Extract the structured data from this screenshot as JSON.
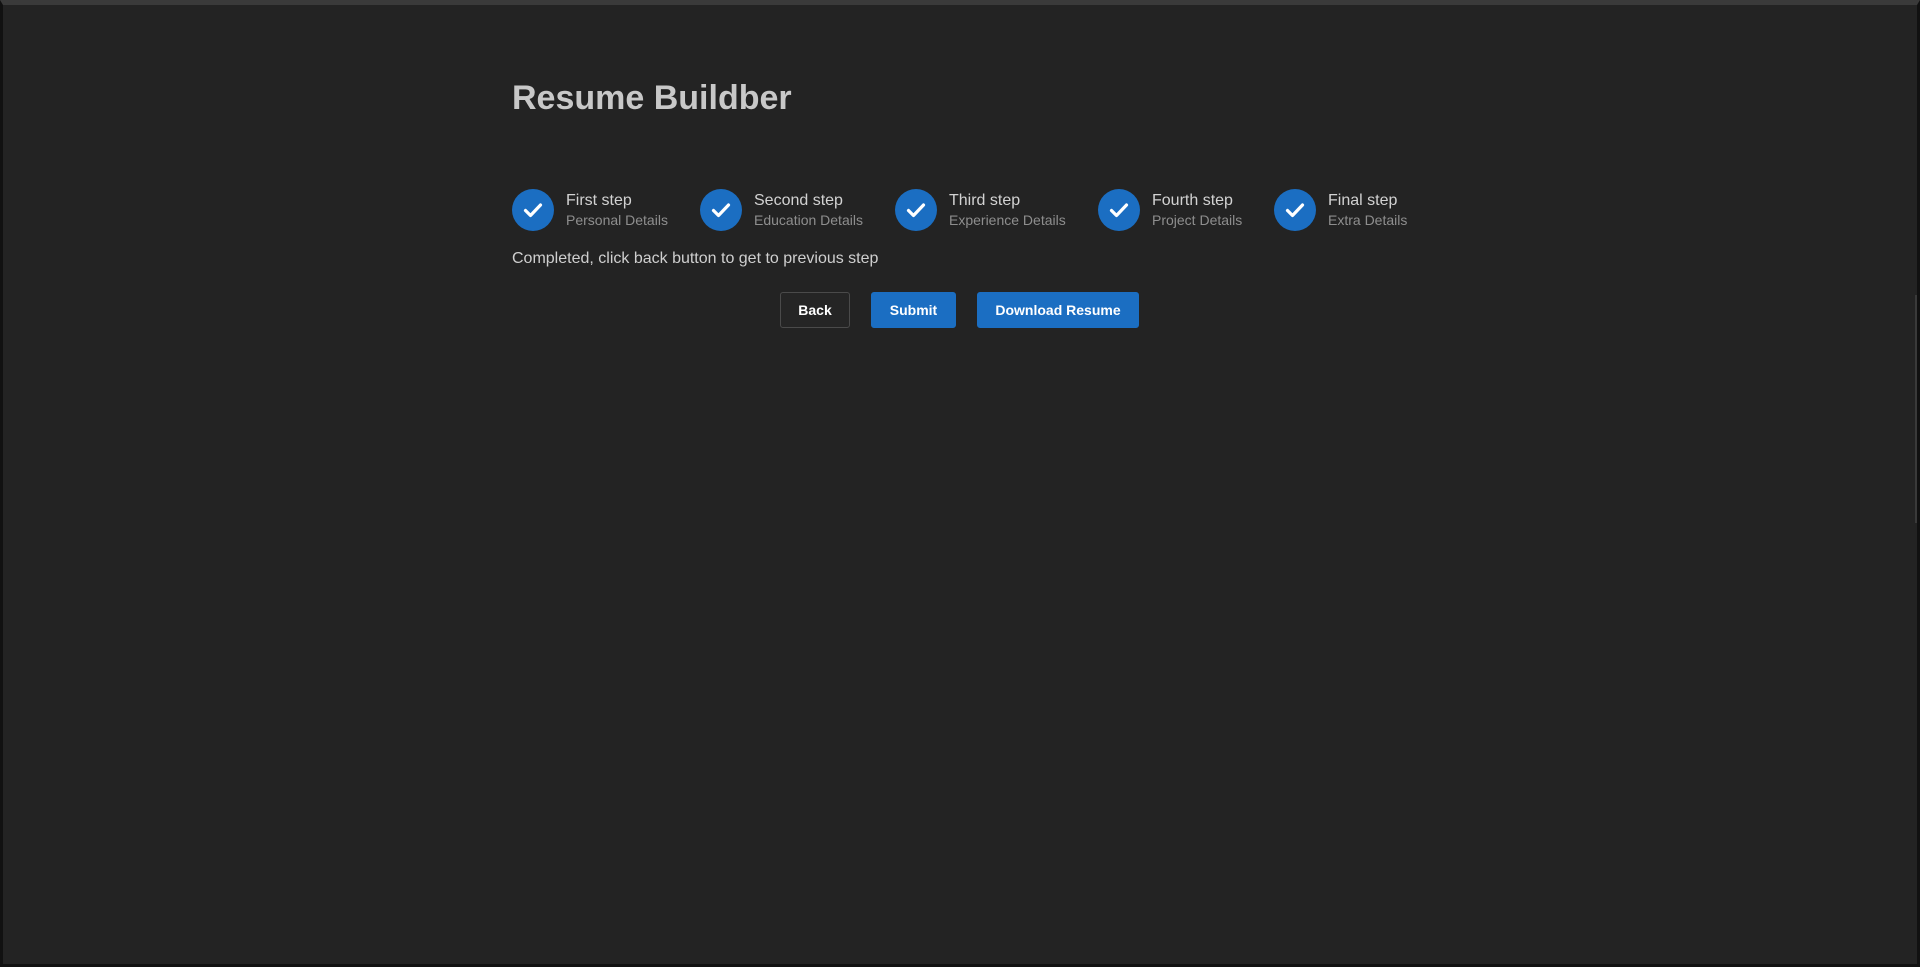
{
  "app": {
    "title": "Resume Buildber"
  },
  "theme": {
    "background": "#232323",
    "accent": "#1b6ec2",
    "title_color": "#c8c8c8",
    "subtitle_color": "#8e8e8e"
  },
  "stepper": {
    "steps": [
      {
        "title": "First step",
        "description": "Personal Details",
        "status": "completed",
        "icon": "check-icon"
      },
      {
        "title": "Second step",
        "description": "Education Details",
        "status": "completed",
        "icon": "check-icon"
      },
      {
        "title": "Third step",
        "description": "Experience Details",
        "status": "completed",
        "icon": "check-icon"
      },
      {
        "title": "Fourth step",
        "description": "Project Details",
        "status": "completed",
        "icon": "check-icon"
      },
      {
        "title": "Final step",
        "description": "Extra Details",
        "status": "completed",
        "icon": "check-icon"
      }
    ]
  },
  "status_message": "Completed, click back button to get to previous step",
  "actions": {
    "back_label": "Back",
    "submit_label": "Submit",
    "download_label": "Download Resume"
  }
}
